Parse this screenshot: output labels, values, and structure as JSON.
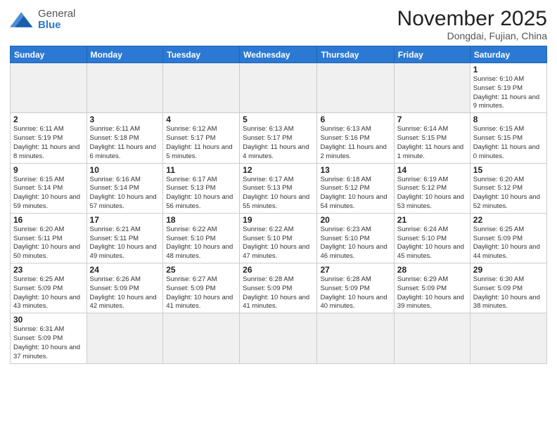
{
  "header": {
    "logo_general": "General",
    "logo_blue": "Blue",
    "month": "November 2025",
    "location": "Dongdai, Fujian, China"
  },
  "weekdays": [
    "Sunday",
    "Monday",
    "Tuesday",
    "Wednesday",
    "Thursday",
    "Friday",
    "Saturday"
  ],
  "weeks": [
    [
      {
        "day": "",
        "empty": true
      },
      {
        "day": "",
        "empty": true
      },
      {
        "day": "",
        "empty": true
      },
      {
        "day": "",
        "empty": true
      },
      {
        "day": "",
        "empty": true
      },
      {
        "day": "",
        "empty": true
      },
      {
        "day": "1",
        "info": "Sunrise: 6:10 AM\nSunset: 5:19 PM\nDaylight: 11 hours and 9 minutes."
      }
    ],
    [
      {
        "day": "2",
        "info": "Sunrise: 6:11 AM\nSunset: 5:19 PM\nDaylight: 11 hours and 8 minutes."
      },
      {
        "day": "3",
        "info": "Sunrise: 6:11 AM\nSunset: 5:18 PM\nDaylight: 11 hours and 6 minutes."
      },
      {
        "day": "4",
        "info": "Sunrise: 6:12 AM\nSunset: 5:17 PM\nDaylight: 11 hours and 5 minutes."
      },
      {
        "day": "5",
        "info": "Sunrise: 6:13 AM\nSunset: 5:17 PM\nDaylight: 11 hours and 4 minutes."
      },
      {
        "day": "6",
        "info": "Sunrise: 6:13 AM\nSunset: 5:16 PM\nDaylight: 11 hours and 2 minutes."
      },
      {
        "day": "7",
        "info": "Sunrise: 6:14 AM\nSunset: 5:15 PM\nDaylight: 11 hours and 1 minute."
      },
      {
        "day": "8",
        "info": "Sunrise: 6:15 AM\nSunset: 5:15 PM\nDaylight: 11 hours and 0 minutes."
      }
    ],
    [
      {
        "day": "9",
        "info": "Sunrise: 6:15 AM\nSunset: 5:14 PM\nDaylight: 10 hours and 59 minutes."
      },
      {
        "day": "10",
        "info": "Sunrise: 6:16 AM\nSunset: 5:14 PM\nDaylight: 10 hours and 57 minutes."
      },
      {
        "day": "11",
        "info": "Sunrise: 6:17 AM\nSunset: 5:13 PM\nDaylight: 10 hours and 56 minutes."
      },
      {
        "day": "12",
        "info": "Sunrise: 6:17 AM\nSunset: 5:13 PM\nDaylight: 10 hours and 55 minutes."
      },
      {
        "day": "13",
        "info": "Sunrise: 6:18 AM\nSunset: 5:12 PM\nDaylight: 10 hours and 54 minutes."
      },
      {
        "day": "14",
        "info": "Sunrise: 6:19 AM\nSunset: 5:12 PM\nDaylight: 10 hours and 53 minutes."
      },
      {
        "day": "15",
        "info": "Sunrise: 6:20 AM\nSunset: 5:12 PM\nDaylight: 10 hours and 52 minutes."
      }
    ],
    [
      {
        "day": "16",
        "info": "Sunrise: 6:20 AM\nSunset: 5:11 PM\nDaylight: 10 hours and 50 minutes."
      },
      {
        "day": "17",
        "info": "Sunrise: 6:21 AM\nSunset: 5:11 PM\nDaylight: 10 hours and 49 minutes."
      },
      {
        "day": "18",
        "info": "Sunrise: 6:22 AM\nSunset: 5:10 PM\nDaylight: 10 hours and 48 minutes."
      },
      {
        "day": "19",
        "info": "Sunrise: 6:22 AM\nSunset: 5:10 PM\nDaylight: 10 hours and 47 minutes."
      },
      {
        "day": "20",
        "info": "Sunrise: 6:23 AM\nSunset: 5:10 PM\nDaylight: 10 hours and 46 minutes."
      },
      {
        "day": "21",
        "info": "Sunrise: 6:24 AM\nSunset: 5:10 PM\nDaylight: 10 hours and 45 minutes."
      },
      {
        "day": "22",
        "info": "Sunrise: 6:25 AM\nSunset: 5:09 PM\nDaylight: 10 hours and 44 minutes."
      }
    ],
    [
      {
        "day": "23",
        "info": "Sunrise: 6:25 AM\nSunset: 5:09 PM\nDaylight: 10 hours and 43 minutes."
      },
      {
        "day": "24",
        "info": "Sunrise: 6:26 AM\nSunset: 5:09 PM\nDaylight: 10 hours and 42 minutes."
      },
      {
        "day": "25",
        "info": "Sunrise: 6:27 AM\nSunset: 5:09 PM\nDaylight: 10 hours and 41 minutes."
      },
      {
        "day": "26",
        "info": "Sunrise: 6:28 AM\nSunset: 5:09 PM\nDaylight: 10 hours and 41 minutes."
      },
      {
        "day": "27",
        "info": "Sunrise: 6:28 AM\nSunset: 5:09 PM\nDaylight: 10 hours and 40 minutes."
      },
      {
        "day": "28",
        "info": "Sunrise: 6:29 AM\nSunset: 5:09 PM\nDaylight: 10 hours and 39 minutes."
      },
      {
        "day": "29",
        "info": "Sunrise: 6:30 AM\nSunset: 5:09 PM\nDaylight: 10 hours and 38 minutes."
      }
    ],
    [
      {
        "day": "30",
        "info": "Sunrise: 6:31 AM\nSunset: 5:09 PM\nDaylight: 10 hours and 37 minutes."
      },
      {
        "day": "",
        "empty": true
      },
      {
        "day": "",
        "empty": true
      },
      {
        "day": "",
        "empty": true
      },
      {
        "day": "",
        "empty": true
      },
      {
        "day": "",
        "empty": true
      },
      {
        "day": "",
        "empty": true
      }
    ]
  ]
}
